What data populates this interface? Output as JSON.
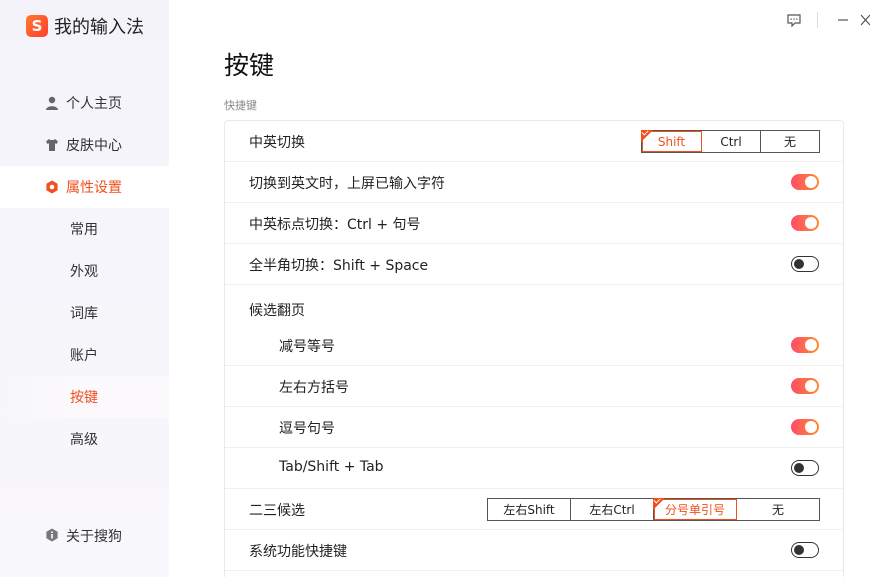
{
  "app": {
    "name": "我的输入法",
    "logo_letter": "S"
  },
  "sidebar": {
    "items": [
      {
        "label": "个人主页",
        "icon": "person-icon"
      },
      {
        "label": "皮肤中心",
        "icon": "shirt-icon"
      },
      {
        "label": "属性设置",
        "icon": "hexagon-settings-icon",
        "active": true
      }
    ],
    "sub_items": [
      {
        "label": "常用"
      },
      {
        "label": "外观"
      },
      {
        "label": "词库"
      },
      {
        "label": "账户"
      },
      {
        "label": "按键",
        "active": true
      },
      {
        "label": "高级"
      }
    ],
    "about": {
      "label": "关于搜狗",
      "icon": "info-icon"
    }
  },
  "window_controls": [
    "feedback-icon",
    "minimize-icon",
    "close-icon"
  ],
  "main": {
    "title": "按键",
    "section_label": "快捷键",
    "rows": {
      "cn_en_switch": {
        "label": "中英切换",
        "options": [
          "Shift",
          "Ctrl",
          "无"
        ],
        "selected": "Shift"
      },
      "commit_on_switch": {
        "label": "切换到英文时，上屏已输入字符",
        "on": true
      },
      "punct_switch": {
        "label": "中英标点切换：Ctrl + 句号",
        "on": true
      },
      "width_switch": {
        "label": "全半角切换：Shift + Space",
        "on": false
      },
      "paging_header": {
        "label": "候选翻页"
      },
      "minus_equal": {
        "label": "减号等号",
        "on": true
      },
      "brackets": {
        "label": "左右方括号",
        "on": true
      },
      "comma_period": {
        "label": "逗号句号",
        "on": true
      },
      "tab": {
        "label": "Tab/Shift + Tab",
        "on": false
      },
      "second_third": {
        "label": "二三候选",
        "options": [
          "左右Shift",
          "左右Ctrl",
          "分号单引号",
          "无"
        ],
        "selected": "分号单引号"
      },
      "system_shortcuts": {
        "label": "系统功能快捷键",
        "on": false
      }
    }
  },
  "colors": {
    "accent": "#f0501e",
    "toggle_on_start": "#ff4d6a",
    "toggle_on_end": "#ff8a2e"
  }
}
